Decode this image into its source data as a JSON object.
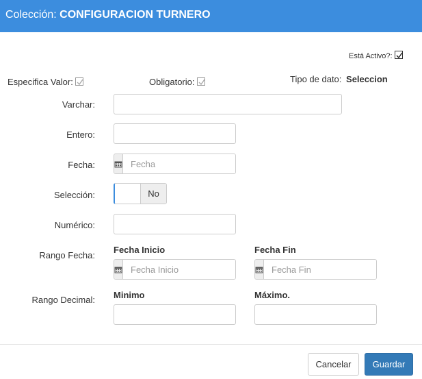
{
  "header": {
    "prefix": "Colección:",
    "title": "CONFIGURACION TURNERO"
  },
  "active": {
    "label": "Está Activo?:",
    "checked": true
  },
  "flags": {
    "especifica_label": "Especifica Valor:",
    "obligatorio_label": "Obligatorio:",
    "tipo_label": "Tipo de dato:",
    "tipo_value": "Seleccion"
  },
  "fields": {
    "varchar_label": "Varchar:",
    "varchar_value": "",
    "entero_label": "Entero:",
    "entero_value": "",
    "fecha_label": "Fecha:",
    "fecha_placeholder": "Fecha",
    "seleccion_label": "Selección:",
    "seleccion_value": "No",
    "numerico_label": "Numérico:",
    "numerico_value": "",
    "rango_fecha_label": "Rango Fecha:",
    "fecha_inicio_label": "Fecha Inicio",
    "fecha_inicio_placeholder": "Fecha Inicio",
    "fecha_fin_label": "Fecha Fin",
    "fecha_fin_placeholder": "Fecha Fin",
    "rango_decimal_label": "Rango Decimal:",
    "minimo_label": "Minimo",
    "maximo_label": "Máximo."
  },
  "buttons": {
    "cancel": "Cancelar",
    "save": "Guardar"
  },
  "colors": {
    "header_bg": "#3c8dde",
    "primary": "#337ab7"
  }
}
